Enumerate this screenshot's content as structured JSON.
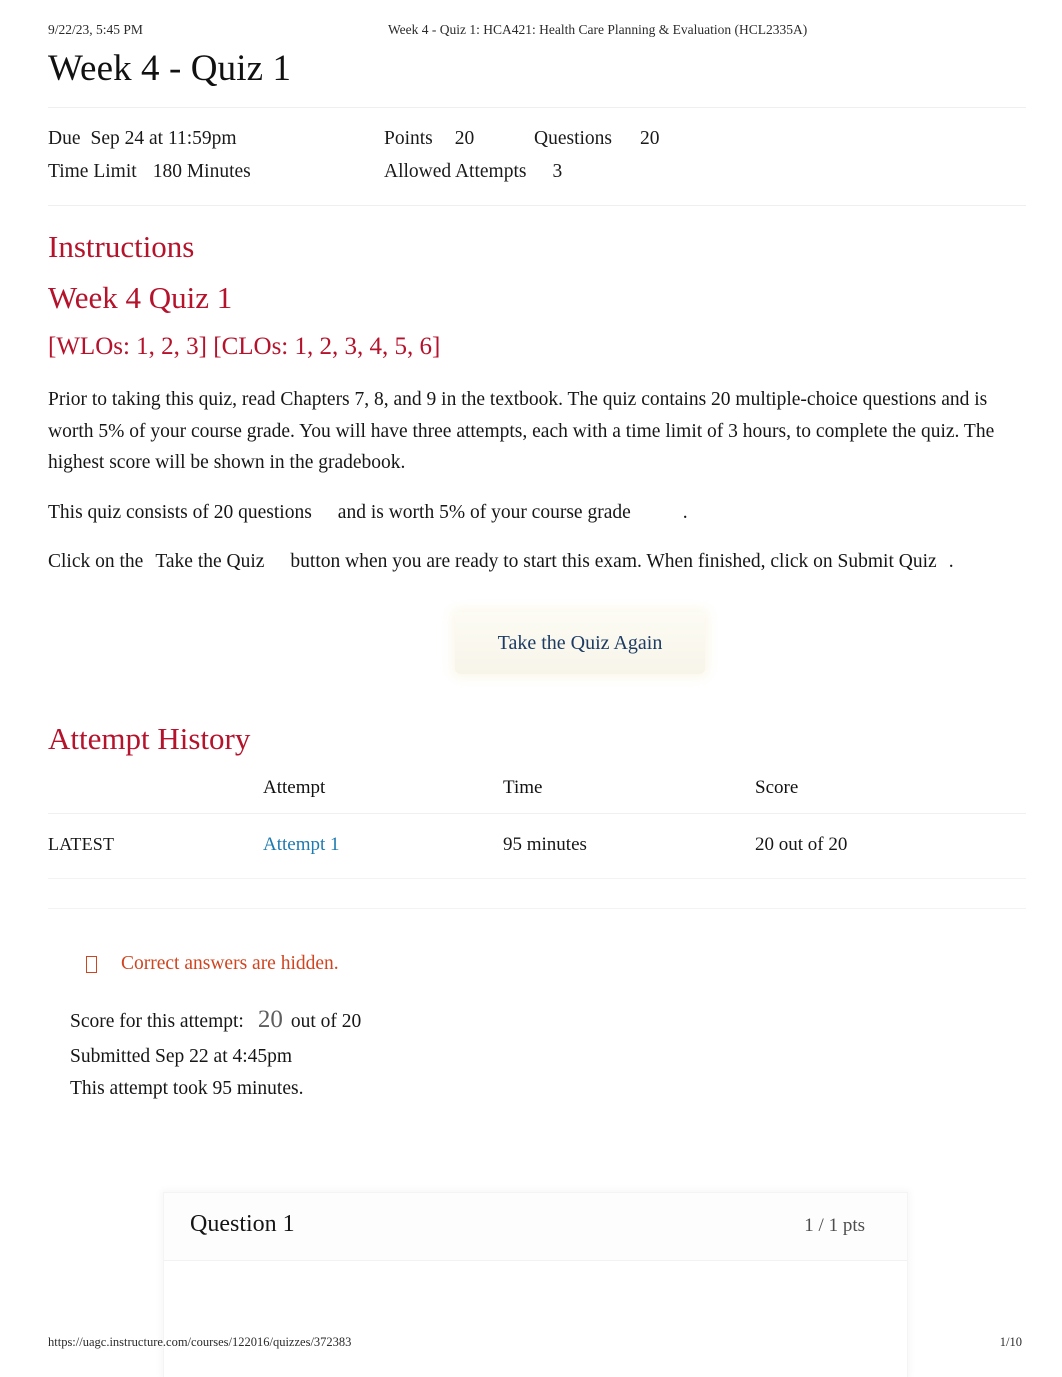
{
  "print": {
    "date": "9/22/23, 5:45 PM",
    "doc_title": "Week 4 - Quiz 1: HCA421: Health Care Planning & Evaluation (HCL2335A)",
    "url": "https://uagc.instructure.com/courses/122016/quizzes/372383",
    "page_number": "1/10"
  },
  "quiz": {
    "title": "Week 4 - Quiz 1",
    "details": {
      "due_label": "Due",
      "due_value": "Sep 24 at 11:59pm",
      "points_label": "Points",
      "points_value": "20",
      "questions_label": "Questions",
      "questions_value": "20",
      "time_limit_label": "Time Limit",
      "time_limit_value": "180 Minutes",
      "allowed_attempts_label": "Allowed Attempts",
      "allowed_attempts_value": "3"
    }
  },
  "instructions": {
    "heading": "Instructions",
    "sub_heading": "Week 4 Quiz 1",
    "outcomes_heading": "[WLOs: 1, 2, 3] [CLOs: 1, 2, 3, 4, 5, 6]",
    "paragraph_1": "Prior to taking this quiz, read Chapters 7, 8, and 9 in the textbook. The quiz contains 20 multiple-choice questions and is worth 5% of your course grade. You will have three attempts, each with a time limit of 3 hours, to complete the quiz. The highest score will be shown in the gradebook.",
    "paragraph_2_a": "This quiz consists of 20 questions",
    "paragraph_2_b": "and is worth 5% of your course grade",
    "paragraph_2_c": ".",
    "paragraph_3_a": "Click on the",
    "paragraph_3_b": "Take the Quiz",
    "paragraph_3_c": "button when you are ready to start this exam. When finished, click on",
    "paragraph_3_d": "Submit Quiz",
    "paragraph_3_e": "."
  },
  "actions": {
    "take_quiz_again": "Take the Quiz Again"
  },
  "attempt_history": {
    "heading": "Attempt History",
    "columns": [
      "",
      "Attempt",
      "Time",
      "Score"
    ],
    "rows": [
      {
        "kept": "LATEST",
        "attempt": "Attempt 1",
        "time": "95 minutes",
        "score": "20 out of 20"
      }
    ]
  },
  "result": {
    "hidden_notice_icon": "info-box-icon",
    "hidden_notice": "Correct answers are hidden.",
    "score_label": "Score for this attempt:",
    "score_value": "20",
    "score_out_of": "out of 20",
    "submitted": "Submitted Sep 22 at 4:45pm",
    "duration": "This attempt took 95 minutes."
  },
  "question": {
    "title": "Question 1",
    "points": "1 / 1 pts"
  },
  "colors": {
    "heading_red": "#b5122b",
    "link_blue": "#1d7ab0",
    "notice_orange": "#cf4520",
    "button_text": "#1d3b63"
  }
}
